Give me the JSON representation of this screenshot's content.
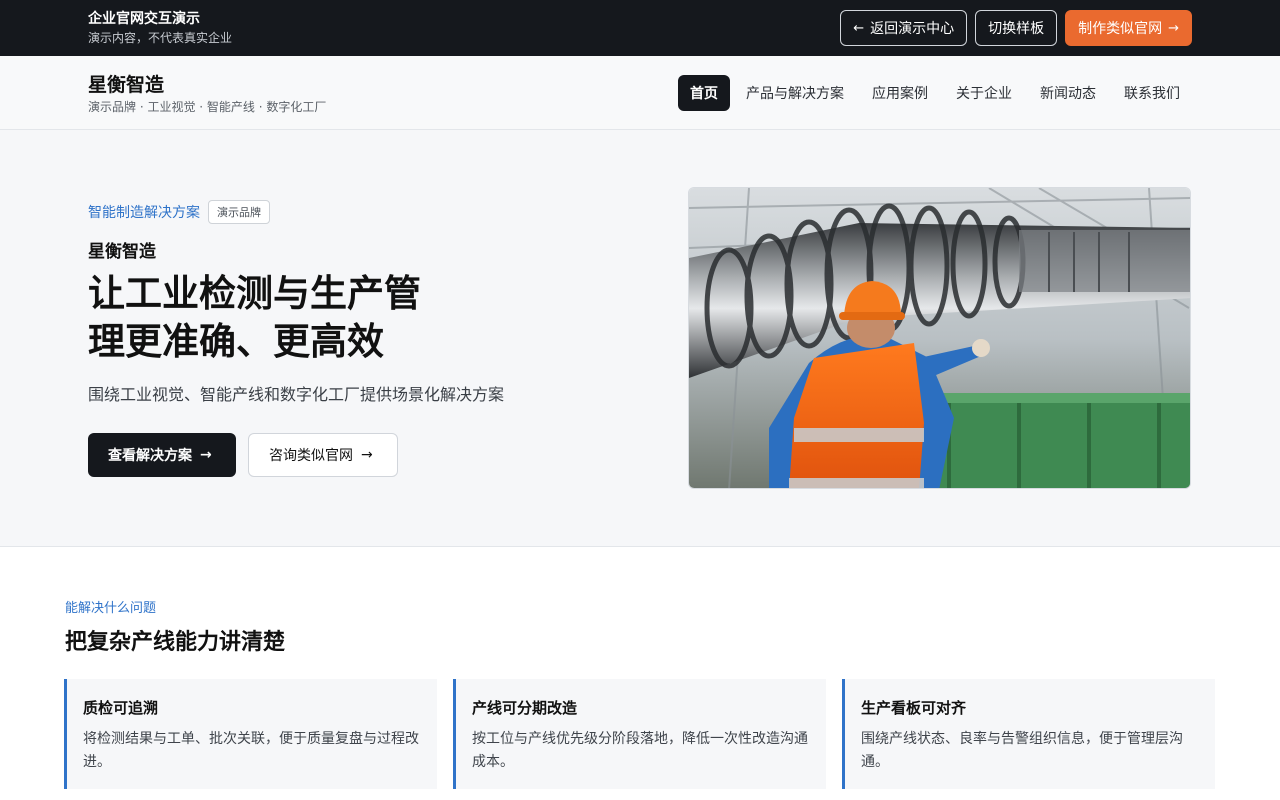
{
  "topbar": {
    "title": "企业官网交互演示",
    "subtitle": "演示内容，不代表真实企业",
    "buttons": {
      "back": "返回演示中心",
      "switch": "切换样板",
      "make": "制作类似官网"
    }
  },
  "header": {
    "brand_name": "星衡智造",
    "brand_tagline": "演示品牌 · 工业视觉 · 智能产线 · 数字化工厂",
    "nav": [
      "首页",
      "产品与解决方案",
      "应用案例",
      "关于企业",
      "新闻动态",
      "联系我们"
    ],
    "active_nav": "首页"
  },
  "hero": {
    "eyebrow": "智能制造解决方案",
    "badge": "演示品牌",
    "brand": "星衡智造",
    "headline": "让工业检测与生产管理更准确、更高效",
    "description": "围绕工业视觉、智能产线和数字化工厂提供场景化解决方案",
    "primary_cta": "查看解决方案",
    "secondary_cta": "咨询类似官网"
  },
  "problems": {
    "kicker": "能解决什么问题",
    "title": "把复杂产线能力讲清楚",
    "cards": [
      {
        "title": "质检可追溯",
        "desc": "将检测结果与工单、批次关联，便于质量复盘与过程改进。"
      },
      {
        "title": "产线可分期改造",
        "desc": "按工位与产线优先级分阶段落地，降低一次性改造沟通成本。"
      },
      {
        "title": "生产看板可对齐",
        "desc": "围绕产线状态、良率与告警组织信息，便于管理层沟通。"
      }
    ]
  },
  "colors": {
    "accent_orange": "#ea6a2f",
    "accent_blue": "#2f73c9",
    "dark": "#15181d"
  },
  "icons": {
    "back": "arrow-left-icon",
    "forward": "arrow-right-icon"
  }
}
